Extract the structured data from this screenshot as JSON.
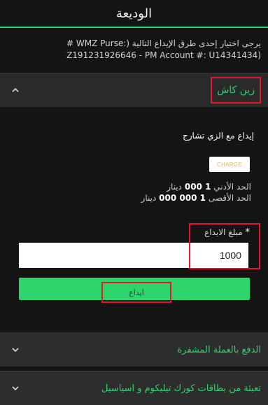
{
  "header": {
    "title": "الوديعة"
  },
  "intro": {
    "line1": "يرجى اختيار إحدى طرق الإيداع التالية (:WMZ Purse #",
    "line2": "Z191231926646 - PM Account #: U14341434)"
  },
  "sections": {
    "zain_cash": {
      "title": "زين كاش",
      "icon": "chevron-up-icon"
    },
    "crypto": {
      "title": "الدفع بالعملة المشفرة",
      "icon": "chevron-down-icon"
    },
    "cards": {
      "title": "تعبئة من بطاقات كورك تيليكوم و اسياسيل",
      "icon": "chevron-down-icon"
    }
  },
  "panel": {
    "method_title": "إيداع مع الزي تشارج",
    "logo_text": "CHARGE",
    "min_label": "الحد الأدني",
    "min_value": "1 000",
    "min_unit": "دينار",
    "max_label": "الحد الأقصى",
    "max_value": "1 000 000",
    "max_unit": "دينار",
    "amount_label": "مبلغ الايداع",
    "required_mark": "*",
    "amount_value": "1000",
    "deposit_button": "ايداع"
  },
  "colors": {
    "accent": "#2ed46c",
    "background": "#141414",
    "section_bg": "#2d2d2d",
    "highlight": "#e4182a"
  }
}
